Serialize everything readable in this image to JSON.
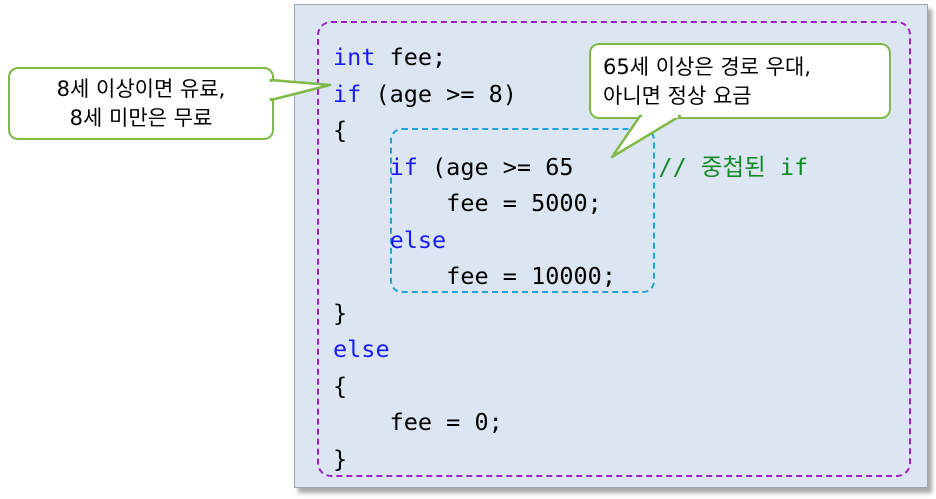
{
  "code_lines": [
    "int fee;",
    "if (age >= 8)",
    "{",
    "    if (age >= 65",
    "        fee = 5000;",
    "    else",
    "        fee = 10000;",
    "}",
    "else",
    "{",
    "    fee = 0;",
    "}"
  ],
  "code_parts": {
    "l1_kw": "int",
    "l1_rest": " fee;",
    "l2_kw": "if",
    "l2_rest": " (age >= 8)",
    "l3": "{",
    "l4_indent": "    ",
    "l4_kw": "if",
    "l4_rest": " (age >= 65",
    "l4_comment": "// 중첩된 if",
    "l5": "        fee = 5000;",
    "l6_indent": "    ",
    "l6_kw": "else",
    "l7": "        fee = 10000;",
    "l8": "}",
    "l9_kw": "else",
    "l10": "{",
    "l11": "    fee = 0;",
    "l12": "}"
  },
  "callouts": {
    "left": {
      "line1": "8세 이상이면 유료,",
      "line2": "8세 미만은 무료"
    },
    "right": {
      "line1": "65세 이상은 경로 우대,",
      "line2": "아니면 정상 요금"
    }
  },
  "colors": {
    "panel_bg": "#dce6f2",
    "keyword": "#1a1aff",
    "comment": "#118a2a",
    "outer_dash": "#a020c8",
    "inner_dash": "#1fa4d6",
    "callout_border": "#7fb947"
  }
}
